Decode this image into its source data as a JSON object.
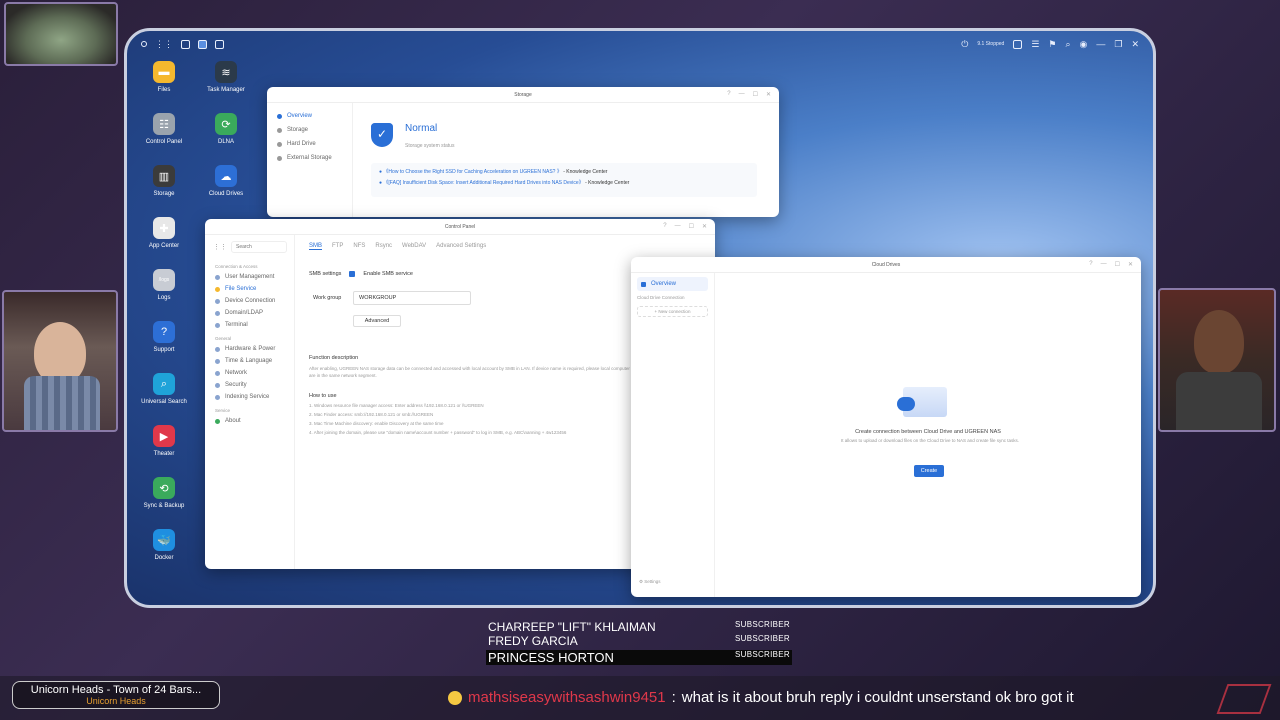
{
  "desktop": {
    "icons": [
      {
        "label": "Files",
        "color": "#f5b82e",
        "glyph": "▬"
      },
      {
        "label": "Task Manager",
        "color": "#2b3a4a",
        "glyph": "≋"
      },
      {
        "label": "Control Panel",
        "color": "#9aa3ad",
        "glyph": "☷"
      },
      {
        "label": "DLNA",
        "color": "#3aaa5c",
        "glyph": "⟳"
      },
      {
        "label": "Storage",
        "color": "#3b3b3b",
        "glyph": "▥"
      },
      {
        "label": "Cloud Drives",
        "color": "#2d6fd6",
        "glyph": "☁"
      },
      {
        "label": "App Center",
        "color": "#e8e8e8",
        "glyph": "✚"
      },
      {
        "label": "Logs",
        "color": "#c8ccd4",
        "glyph": "/logs"
      },
      {
        "label": "Support",
        "color": "#2d6fd6",
        "glyph": "?"
      },
      {
        "label": "Universal Search",
        "color": "#1fa3d9",
        "glyph": "⌕"
      },
      {
        "label": "Theater",
        "color": "#e0384a",
        "glyph": "▶"
      },
      {
        "label": "Sync & Backup",
        "color": "#3aaa5c",
        "glyph": "⟲"
      },
      {
        "label": "Docker",
        "color": "#1f8fe0",
        "glyph": "🐳"
      }
    ]
  },
  "topbar": {
    "status_text": "9.1 Stopped"
  },
  "storage_window": {
    "title": "Storage",
    "sidebar": [
      "Overview",
      "Storage",
      "Hard Drive",
      "External Storage"
    ],
    "status": "Normal",
    "status_sub": "Storage system status",
    "links": [
      {
        "text": "《How to Choose the Right SSD for Caching Acceleration on UGREEN NAS? 》",
        "suffix": "- Knowledge Center"
      },
      {
        "text": "《[FAQ] Insufficient Disk Space: Insert Additional Required Hard Drives into NAS Device》",
        "suffix": "- Knowledge Center"
      }
    ]
  },
  "control_panel": {
    "title": "Control Panel",
    "search_placeholder": "Search",
    "tabs": [
      "SMB",
      "FTP",
      "NFS",
      "Rsync",
      "WebDAV",
      "Advanced Settings"
    ],
    "sections": [
      {
        "header": "Connection & Access",
        "items": [
          "User Management",
          "File Service",
          "Device Connection",
          "Domain/LDAP",
          "Terminal"
        ]
      },
      {
        "header": "General",
        "items": [
          "Hardware & Power",
          "Time & Language",
          "Network",
          "Security",
          "Indexing Service"
        ]
      },
      {
        "header": "Service",
        "items": [
          "About"
        ]
      }
    ],
    "smb_settings_label": "SMB settings",
    "enable_smb": "Enable SMB service",
    "workgroup_label": "Work group",
    "workgroup_value": "WORKGROUP",
    "advanced_btn": "Advanced",
    "func_desc_title": "Function description",
    "func_desc_text": "After enabling, UGREEN NAS storage data can be connected and accessed with local account by SMB in LAN. If device name is required, please local computer are in the same network segment.",
    "howto_title": "How to use",
    "howto_lines": [
      "1. Windows resource file manager access: Enter address \\\\192.168.0.121 or \\\\UGREEN",
      "2. Mac Finder access: smb://192.168.0.121 or smb://UGREEN",
      "3. Mac Time Machine discovery: enable Discovery at the same time",
      "4. After joining the domain, please use \"domain name\\account number + password\" to log in SMB, e.g. ABC\\nanning + 4w123456"
    ],
    "discovery_link": "Discovery"
  },
  "cloud_window": {
    "title": "Cloud Drives",
    "sidebar_active": "Overview",
    "sidebar_section": "Cloud Drive Connection",
    "new_connection": "New connection",
    "settings": "Settings",
    "heading": "Create connection between Cloud Drive and UGREEN NAS",
    "subtext": "It allows to upload or download files on the Cloud Drive to NAS and create file sync tasks.",
    "create_btn": "Create"
  },
  "overlay": {
    "subscribers": [
      {
        "name": "CHARREEP \"LIFT\" KHLAIMAN",
        "badge": "SUBSCRIBER"
      },
      {
        "name": "FREDY GARCIA",
        "badge": "SUBSCRIBER"
      },
      {
        "name": "PRINCESS HORTON",
        "badge": "SUBSCRIBER"
      }
    ],
    "stream_title": "Unicorn Heads - Town of 24 Bars...",
    "stream_subtitle": "Unicorn Heads",
    "chat_user": "mathsiseasywithsashwin9451",
    "chat_message": "what is it about  bruh reply i couldnt unserstand  ok bro got it",
    "chat_user_color": "#e0384a",
    "accent": "#2a6fd6"
  }
}
